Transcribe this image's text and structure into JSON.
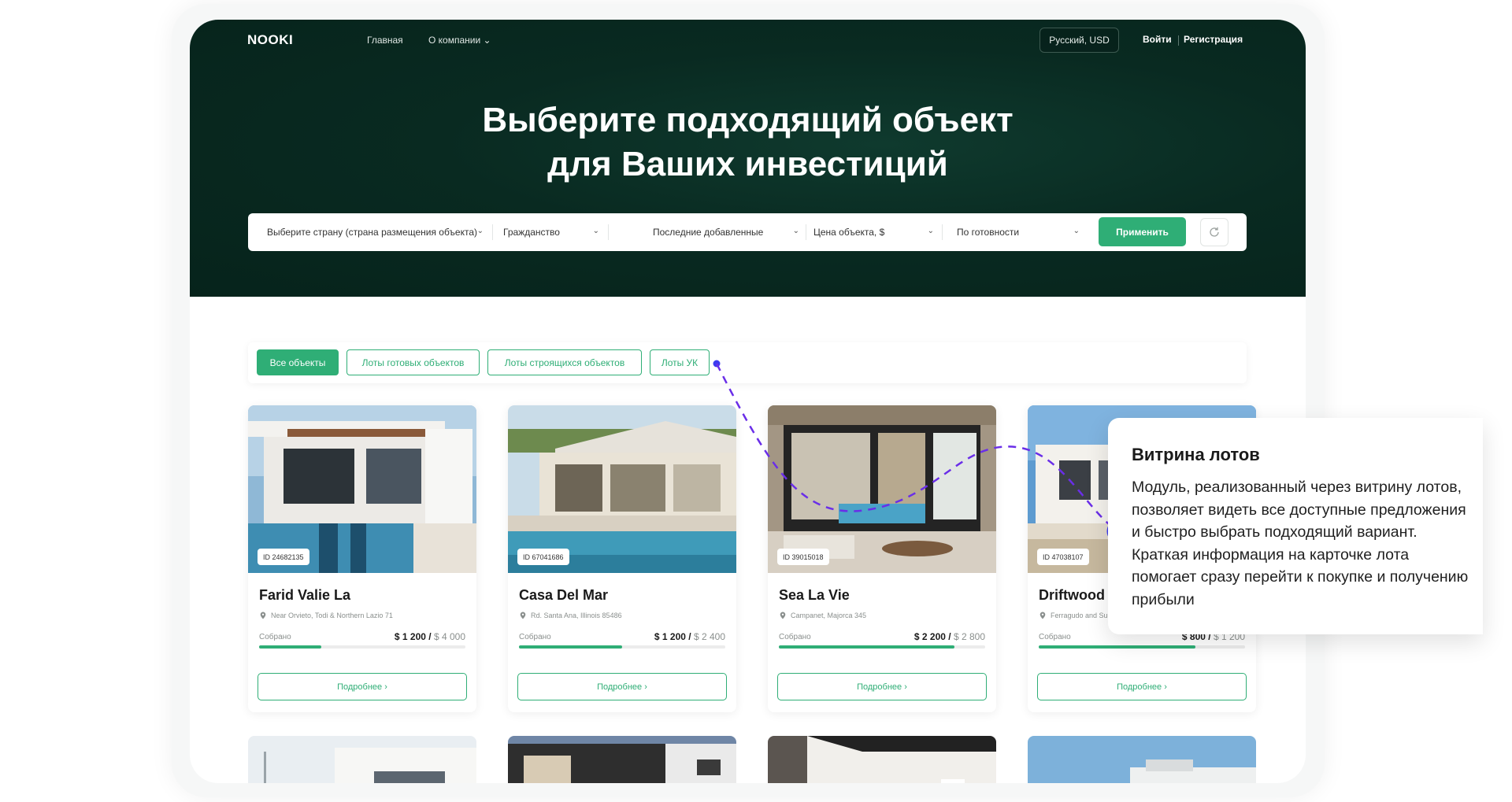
{
  "header": {
    "logo": "NOOKI",
    "nav_home": "Главная",
    "nav_about": "О компании ⌄",
    "lang_currency": "Русский, USD",
    "login": "Войти",
    "register": "Регистрация"
  },
  "hero": {
    "title_line1": "Выберите подходящий объект",
    "title_line2": "для Ваших инвестиций"
  },
  "filters": {
    "country": "Выберите страну (страна размещения объекта)",
    "citizenship": "Гражданство",
    "sort": "Последние добавленные",
    "price": "Цена объекта, $",
    "readiness": "По готовности",
    "apply_label": "Применить",
    "reset_icon": "refresh-icon"
  },
  "tabs": {
    "all": "Все объекты",
    "ready": "Лоты готовых объектов",
    "building": "Лоты строящихся объектов",
    "uk": "Лоты УК"
  },
  "cards": [
    {
      "id": "ID 24682135",
      "name": "Farid Valie La",
      "location": "Near Orvieto, Todi & Northern Lazio 71",
      "raised_label": "Собрано",
      "raised": "$ 1 200",
      "goal": "$ 4 000",
      "progress": 0.3,
      "more": "Подробнее  ›"
    },
    {
      "id": "ID 67041686",
      "name": "Casa Del Mar",
      "location": "Rd. Santa Ana, Illinois 85486",
      "raised_label": "Собрано",
      "raised": "$ 1 200",
      "goal": "$ 2 400",
      "progress": 0.5,
      "more": "Подробнее  ›"
    },
    {
      "id": "ID 39015018",
      "name": "Sea La Vie",
      "location": "Campanet, Majorca 345",
      "raised_label": "Собрано",
      "raised": "$ 2 200",
      "goal": "$ 2 800",
      "progress": 0.85,
      "more": "Подробнее  ›"
    },
    {
      "id": "ID 47038107",
      "name": "Driftwood V",
      "location": "Ferragudo and Surro",
      "raised_label": "Собрано",
      "raised": "$ 800",
      "goal": "$ 1 200",
      "progress": 0.76,
      "more": "Подробнее  ›"
    }
  ],
  "tooltip": {
    "title": "Витрина лотов",
    "body": "Модуль, реализованный через витрину лотов, позволяет видеть все доступные предложения и быстро выбрать подходящий вариант. Краткая информация на карточке лота помогает сразу перейти к покупке и получению прибыли"
  },
  "colors": {
    "accent": "#2fae76",
    "hero_bg": "#082a20",
    "annotation": "#3b3bf0"
  }
}
